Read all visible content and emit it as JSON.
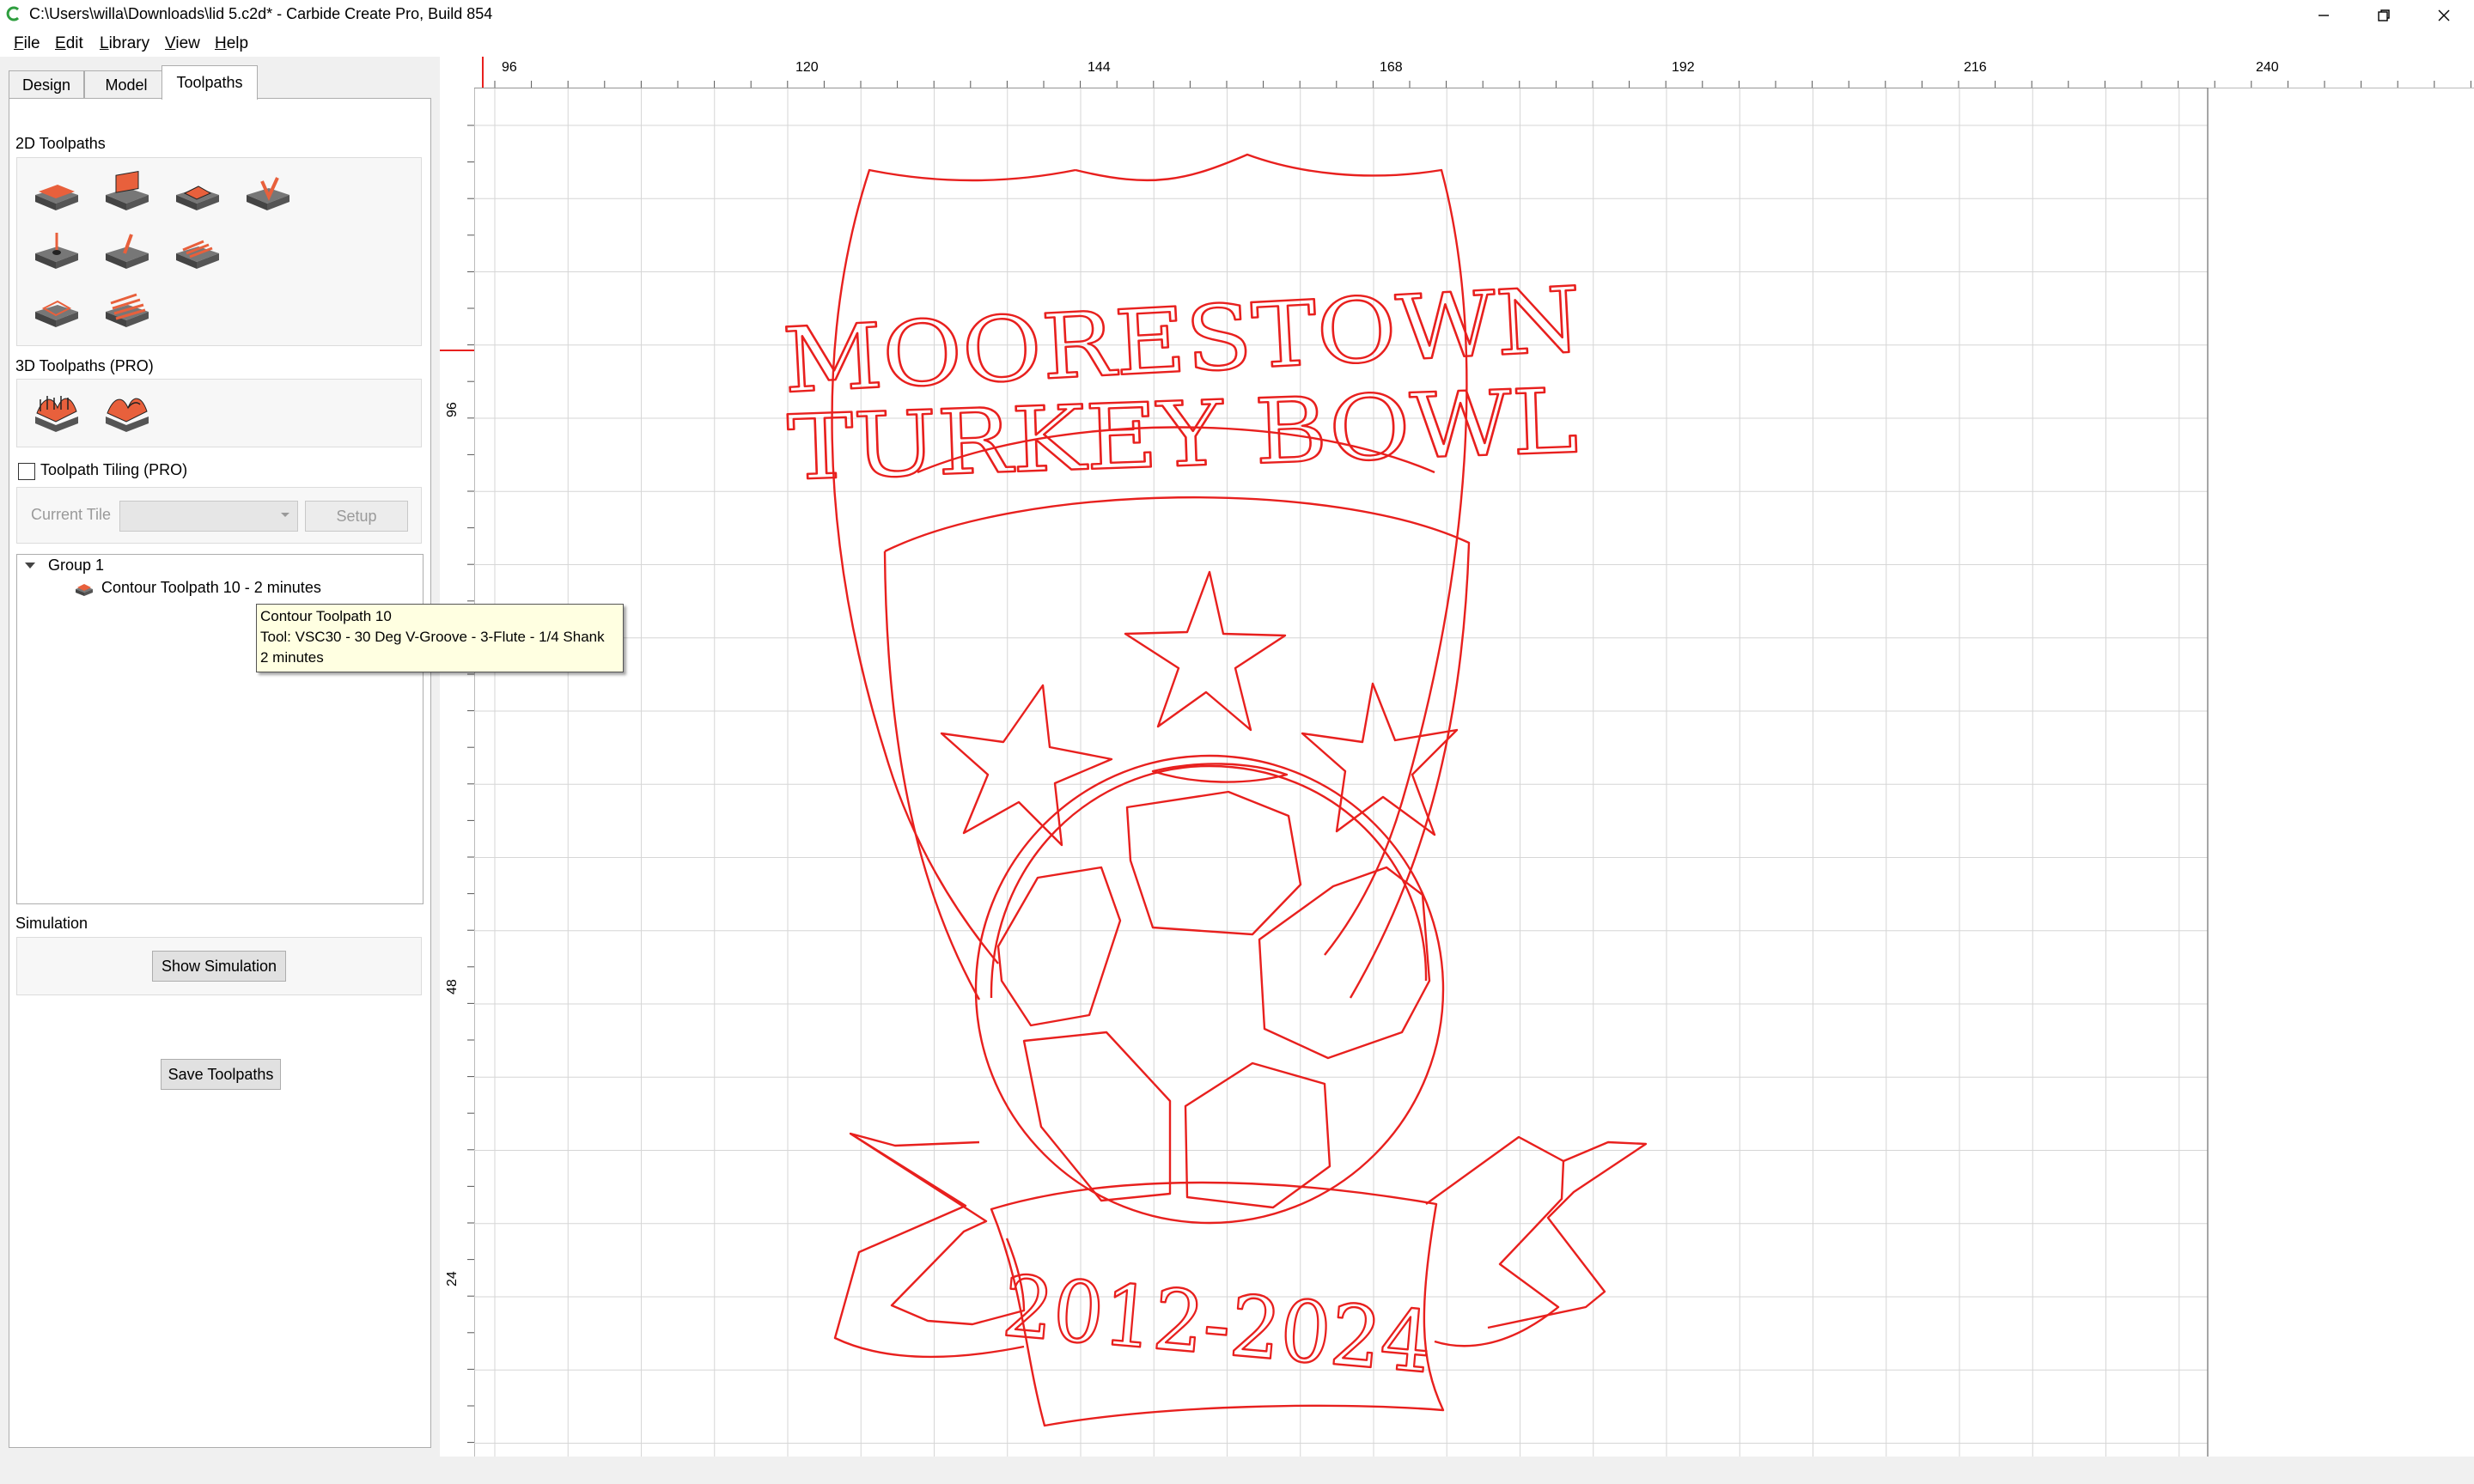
{
  "window": {
    "title": "C:\\Users\\willa\\Downloads\\lid 5.c2d* - Carbide Create Pro, Build 854"
  },
  "menu": {
    "items": [
      {
        "label_first": "F",
        "label_rest": "ile"
      },
      {
        "label_first": "E",
        "label_rest": "dit"
      },
      {
        "label_first": "L",
        "label_rest": "ibrary"
      },
      {
        "label_first": "V",
        "label_rest": "iew"
      },
      {
        "label_first": "H",
        "label_rest": "elp"
      }
    ]
  },
  "tabs": [
    "Design",
    "Model",
    "Toolpaths"
  ],
  "active_tab": "Toolpaths",
  "panel": {
    "toolpaths_2d_label": "2D Toolpaths",
    "toolpaths_3d_label": "3D Toolpaths (PRO)",
    "tiling_label": "Toolpath Tiling (PRO)",
    "tiling_checked": false,
    "current_tile_label": "Current Tile",
    "current_tile_value": "",
    "setup_label": "Setup",
    "simulation_label": "Simulation",
    "show_simulation_label": "Show Simulation",
    "save_toolpaths_label": "Save Toolpaths"
  },
  "toolpath_icons_2d": [
    "contour-toolpath-icon",
    "pocket-toolpath-icon",
    "advanced-pocket-toolpath-icon",
    "v-carve-toolpath-icon",
    "drill-toolpath-icon",
    "engrave-toolpath-icon",
    "texture-toolpath-icon",
    "chamfer-toolpath-icon",
    "flatten-toolpath-icon"
  ],
  "toolpath_icons_3d": [
    "3d-rough-toolpath-icon",
    "3d-finish-toolpath-icon"
  ],
  "tree": {
    "group_label": "Group 1",
    "item_label": "Contour Toolpath 10 - 2 minutes"
  },
  "tooltip": {
    "line1": "Contour Toolpath 10",
    "line2": "Tool: VSC30 - 30 Deg V-Groove - 3-Flute - 1/4 Shank",
    "line3": "2 minutes"
  },
  "rulers": {
    "top": [
      "96",
      "120",
      "144",
      "168",
      "192",
      "216",
      "240"
    ],
    "left": [
      "96",
      "48",
      "24"
    ]
  },
  "design": {
    "line1": "MOORESTOWN",
    "line2": "TURKEY BOWL",
    "years": "2012-2024",
    "stroke_color": "#e8201e"
  },
  "colors": {
    "accent": "#e8201e",
    "icon_orange": "#e8603c"
  }
}
